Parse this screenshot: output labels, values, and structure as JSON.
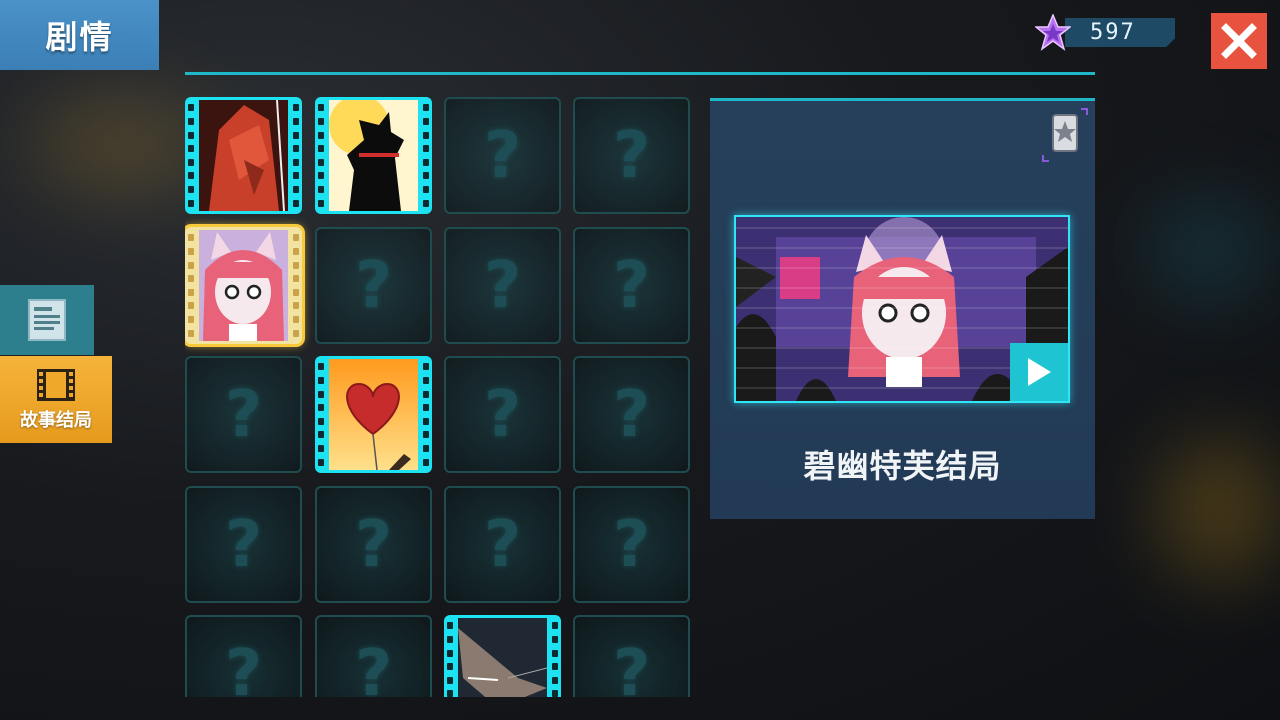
{
  "header": {
    "title": "剧情"
  },
  "currency": {
    "amount": "597",
    "icon": "purple-star-icon"
  },
  "close": {
    "icon": "close-icon"
  },
  "side_tabs": [
    {
      "icon": "document-icon",
      "label": ""
    },
    {
      "icon": "film-icon",
      "label": "故事结局",
      "active": true
    }
  ],
  "grid": {
    "locked_symbol": "?",
    "cells": [
      {
        "state": "unlocked",
        "art": "red-warrior"
      },
      {
        "state": "unlocked",
        "art": "black-ninja"
      },
      {
        "state": "locked"
      },
      {
        "state": "locked"
      },
      {
        "state": "unlocked",
        "art": "pink-cat-girl",
        "selected": true
      },
      {
        "state": "locked"
      },
      {
        "state": "locked"
      },
      {
        "state": "locked"
      },
      {
        "state": "locked"
      },
      {
        "state": "unlocked",
        "art": "heart-balloon"
      },
      {
        "state": "locked"
      },
      {
        "state": "locked"
      },
      {
        "state": "locked"
      },
      {
        "state": "locked"
      },
      {
        "state": "locked"
      },
      {
        "state": "locked"
      },
      {
        "state": "locked"
      },
      {
        "state": "locked"
      },
      {
        "state": "unlocked",
        "art": "wing-blade"
      },
      {
        "state": "locked"
      }
    ]
  },
  "detail": {
    "title": "碧幽特芙结局",
    "preview_art": "pink-cat-girl-stage",
    "play_icon": "play-icon",
    "corner_icon": "star-card-icon"
  },
  "colors": {
    "accent": "#1fb8c8",
    "active_tab": "#f6b43a",
    "close": "#e8533f",
    "title_tab": "#4a92c9"
  }
}
